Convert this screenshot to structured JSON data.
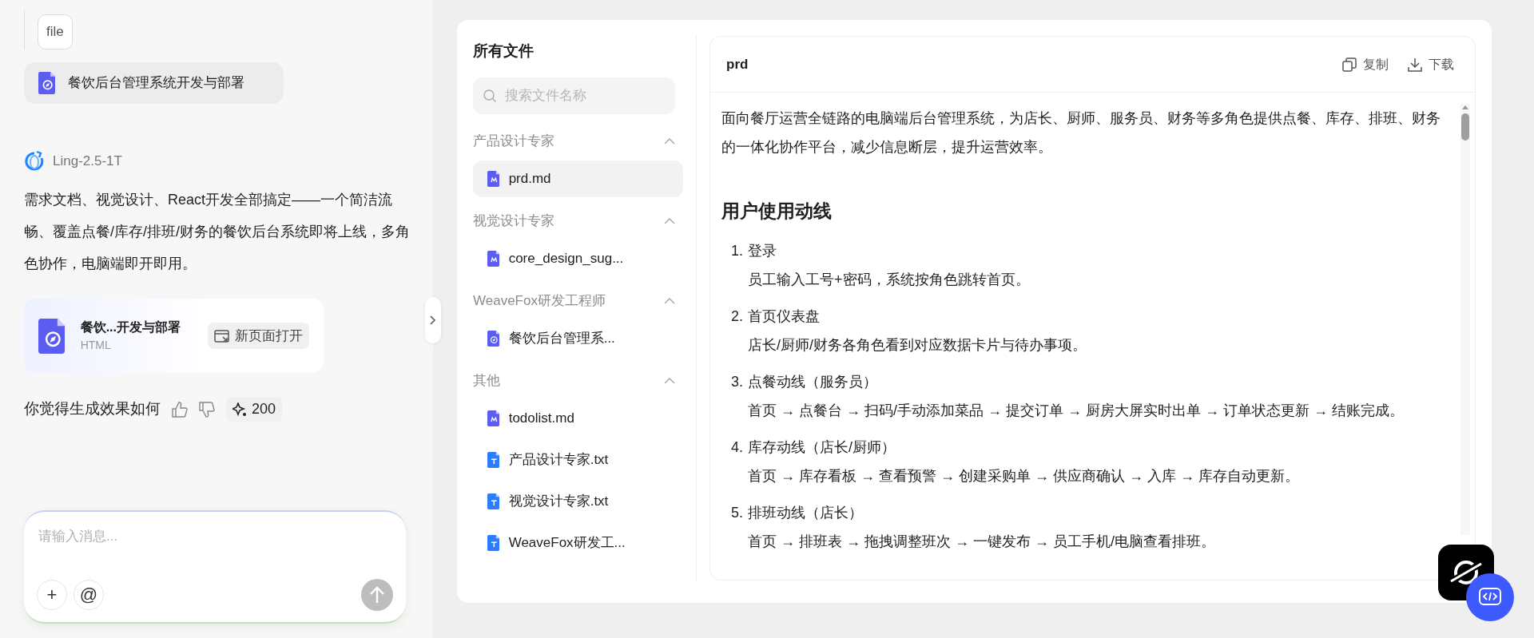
{
  "chat": {
    "attachment_tag": "file",
    "doc_chip": {
      "title": "餐饮后台管理系统开发与部署"
    },
    "model": {
      "name": "Ling-2.5-1T"
    },
    "message": "需求文档、视觉设计、React开发全部搞定——一个简洁流畅、覆盖点餐/库存/排班/财务的餐饮后台系统即将上线，多角色协作，电脑端即开即用。",
    "artifact": {
      "title": "餐饮...开发与部署",
      "type": "HTML",
      "open_button": "新页面打开"
    },
    "feedback": {
      "question": "你觉得生成效果如何",
      "credits": "200"
    },
    "input": {
      "placeholder": "请输入消息...",
      "buttons": [
        "+",
        "@"
      ]
    }
  },
  "files": {
    "title": "所有文件",
    "search": {
      "placeholder": "搜索文件名称"
    },
    "groups": [
      {
        "name": "产品设计专家",
        "expanded": true,
        "items": [
          {
            "name": "prd.md",
            "kind": "md",
            "selected": true
          }
        ]
      },
      {
        "name": "视觉设计专家",
        "expanded": true,
        "items": [
          {
            "name": "core_design_sug...",
            "kind": "md",
            "selected": false
          }
        ]
      },
      {
        "name": "WeaveFox研发工程师",
        "expanded": true,
        "items": [
          {
            "name": "餐饮后台管理系...",
            "kind": "html",
            "selected": false
          }
        ]
      },
      {
        "name": "其他",
        "expanded": true,
        "items": [
          {
            "name": "todolist.md",
            "kind": "md",
            "selected": false
          },
          {
            "name": "产品设计专家.txt",
            "kind": "txt",
            "selected": false
          },
          {
            "name": "视觉设计专家.txt",
            "kind": "txt",
            "selected": false
          },
          {
            "name": "WeaveFox研发工...",
            "kind": "txt",
            "selected": false
          }
        ]
      }
    ]
  },
  "preview": {
    "title": "prd",
    "actions": [
      {
        "kind": "copy",
        "label": "复制"
      },
      {
        "kind": "download",
        "label": "下载"
      }
    ],
    "intro": "面向餐厅运营全链路的电脑端后台管理系统，为店长、厨师、服务员、财务等多角色提供点餐、库存、排班、财务的一体化协作平台，减少信息断层，提升运营效率。",
    "heading": "用户使用动线",
    "steps": [
      {
        "number": "1.",
        "title": "登录",
        "detail": "员工输入工号+密码，系统按角色跳转首页。"
      },
      {
        "number": "2.",
        "title": "首页仪表盘",
        "detail": "店长/厨师/财务各角色看到对应数据卡片与待办事项。"
      },
      {
        "number": "3.",
        "title": "点餐动线（服务员）",
        "detail": "首页 → 点餐台 → 扫码/手动添加菜品 → 提交订单 → 厨房大屏实时出单 → 订单状态更新 → 结账完成。"
      },
      {
        "number": "4.",
        "title": "库存动线（店长/厨师）",
        "detail": "首页 → 库存看板 → 查看预警 → 创建采购单 → 供应商确认 → 入库 → 库存自动更新。"
      },
      {
        "number": "5.",
        "title": "排班动线（店长）",
        "detail": "首页 → 排班表 → 拖拽调整班次 → 一键发布 → 员工手机/电脑查看排班。"
      }
    ]
  }
}
